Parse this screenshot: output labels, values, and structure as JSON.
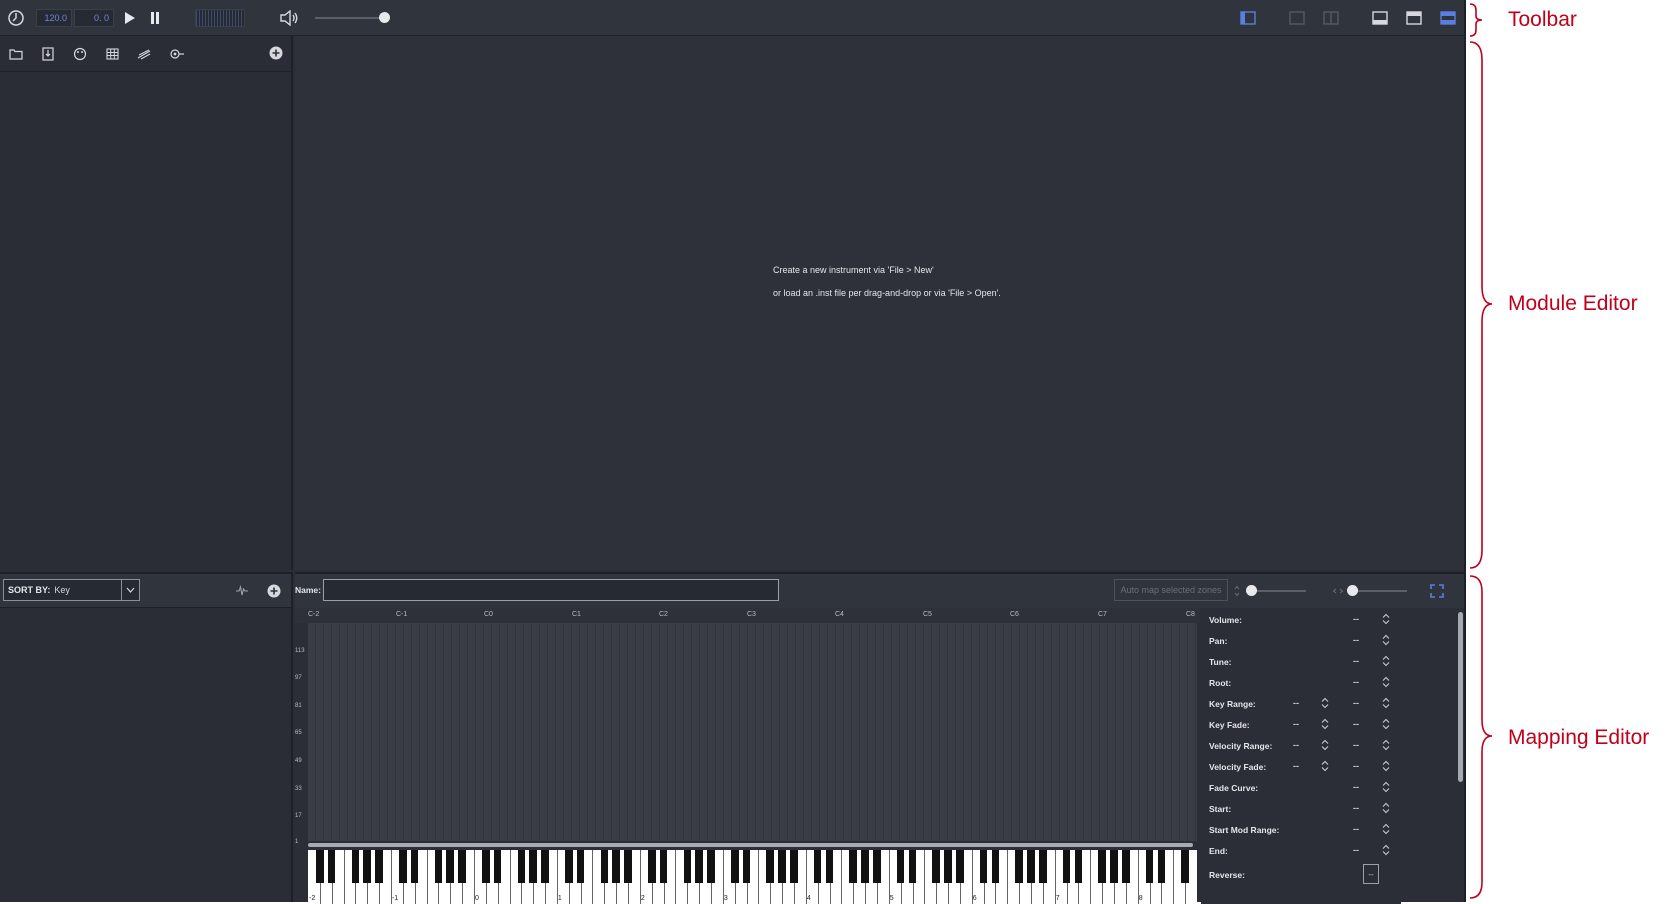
{
  "toolbar": {
    "tempo": "120.0",
    "position": "0. 0"
  },
  "module_editor": {
    "message_line1": "Create a new instrument via 'File > New'",
    "message_line2": "or load an .inst file per drag-and-drop or via 'File > Open'."
  },
  "sort": {
    "label": "SORT BY:",
    "value": "Key"
  },
  "mapping": {
    "name_label": "Name:",
    "name_value": "",
    "automap_label": "Auto map selected zones",
    "octaves": [
      "C-2",
      "C-1",
      "C0",
      "C1",
      "C2",
      "C3",
      "C4",
      "C5",
      "C6",
      "C7",
      "C8"
    ],
    "velocities": [
      "113",
      "97",
      "81",
      "65",
      "49",
      "33",
      "17",
      "1"
    ],
    "keyboard_labels": [
      "-2",
      "-1",
      "0",
      "1",
      "2",
      "3",
      "4",
      "5",
      "6",
      "7",
      "8"
    ],
    "properties": [
      {
        "label": "Volume:",
        "value": "--",
        "range": false
      },
      {
        "label": "Pan:",
        "value": "--",
        "range": false
      },
      {
        "label": "Tune:",
        "value": "--",
        "range": false
      },
      {
        "label": "Root:",
        "value": "--",
        "range": false
      },
      {
        "label": "Key Range:",
        "low": "--",
        "value": "--",
        "range": true
      },
      {
        "label": "Key Fade:",
        "low": "--",
        "value": "--",
        "range": true
      },
      {
        "label": "Velocity Range:",
        "low": "--",
        "value": "--",
        "range": true
      },
      {
        "label": "Velocity Fade:",
        "low": "--",
        "value": "--",
        "range": true
      },
      {
        "label": "Fade Curve:",
        "value": "--",
        "range": false
      },
      {
        "label": "Start:",
        "value": "--",
        "range": false
      },
      {
        "label": "Start Mod Range:",
        "value": "--",
        "range": false
      },
      {
        "label": "End:",
        "value": "--",
        "range": false
      }
    ],
    "reverse_label": "Reverse:",
    "reverse_value": "--"
  },
  "annotations": {
    "toolbar": "Toolbar",
    "module_editor": "Module Editor",
    "mapping_editor": "Mapping Editor"
  },
  "colors": {
    "accent": "#5b7fe0",
    "annotation": "#c0001a",
    "background": "#2b2e36"
  },
  "icons": {
    "toolbar_left": [
      "metronome-icon",
      "play-icon",
      "pause-icon",
      "volume-icon"
    ],
    "toolbar_right": [
      "layout-left-panel-icon",
      "layout-single-icon",
      "layout-split-icon",
      "layout-bottom-panel-icon",
      "layout-top-panel-icon",
      "layout-both-panels-icon"
    ],
    "left_panel": [
      "folder-icon",
      "save-icon",
      "palette-icon",
      "table-icon",
      "effects-icon",
      "modulation-icon",
      "add-icon"
    ]
  }
}
